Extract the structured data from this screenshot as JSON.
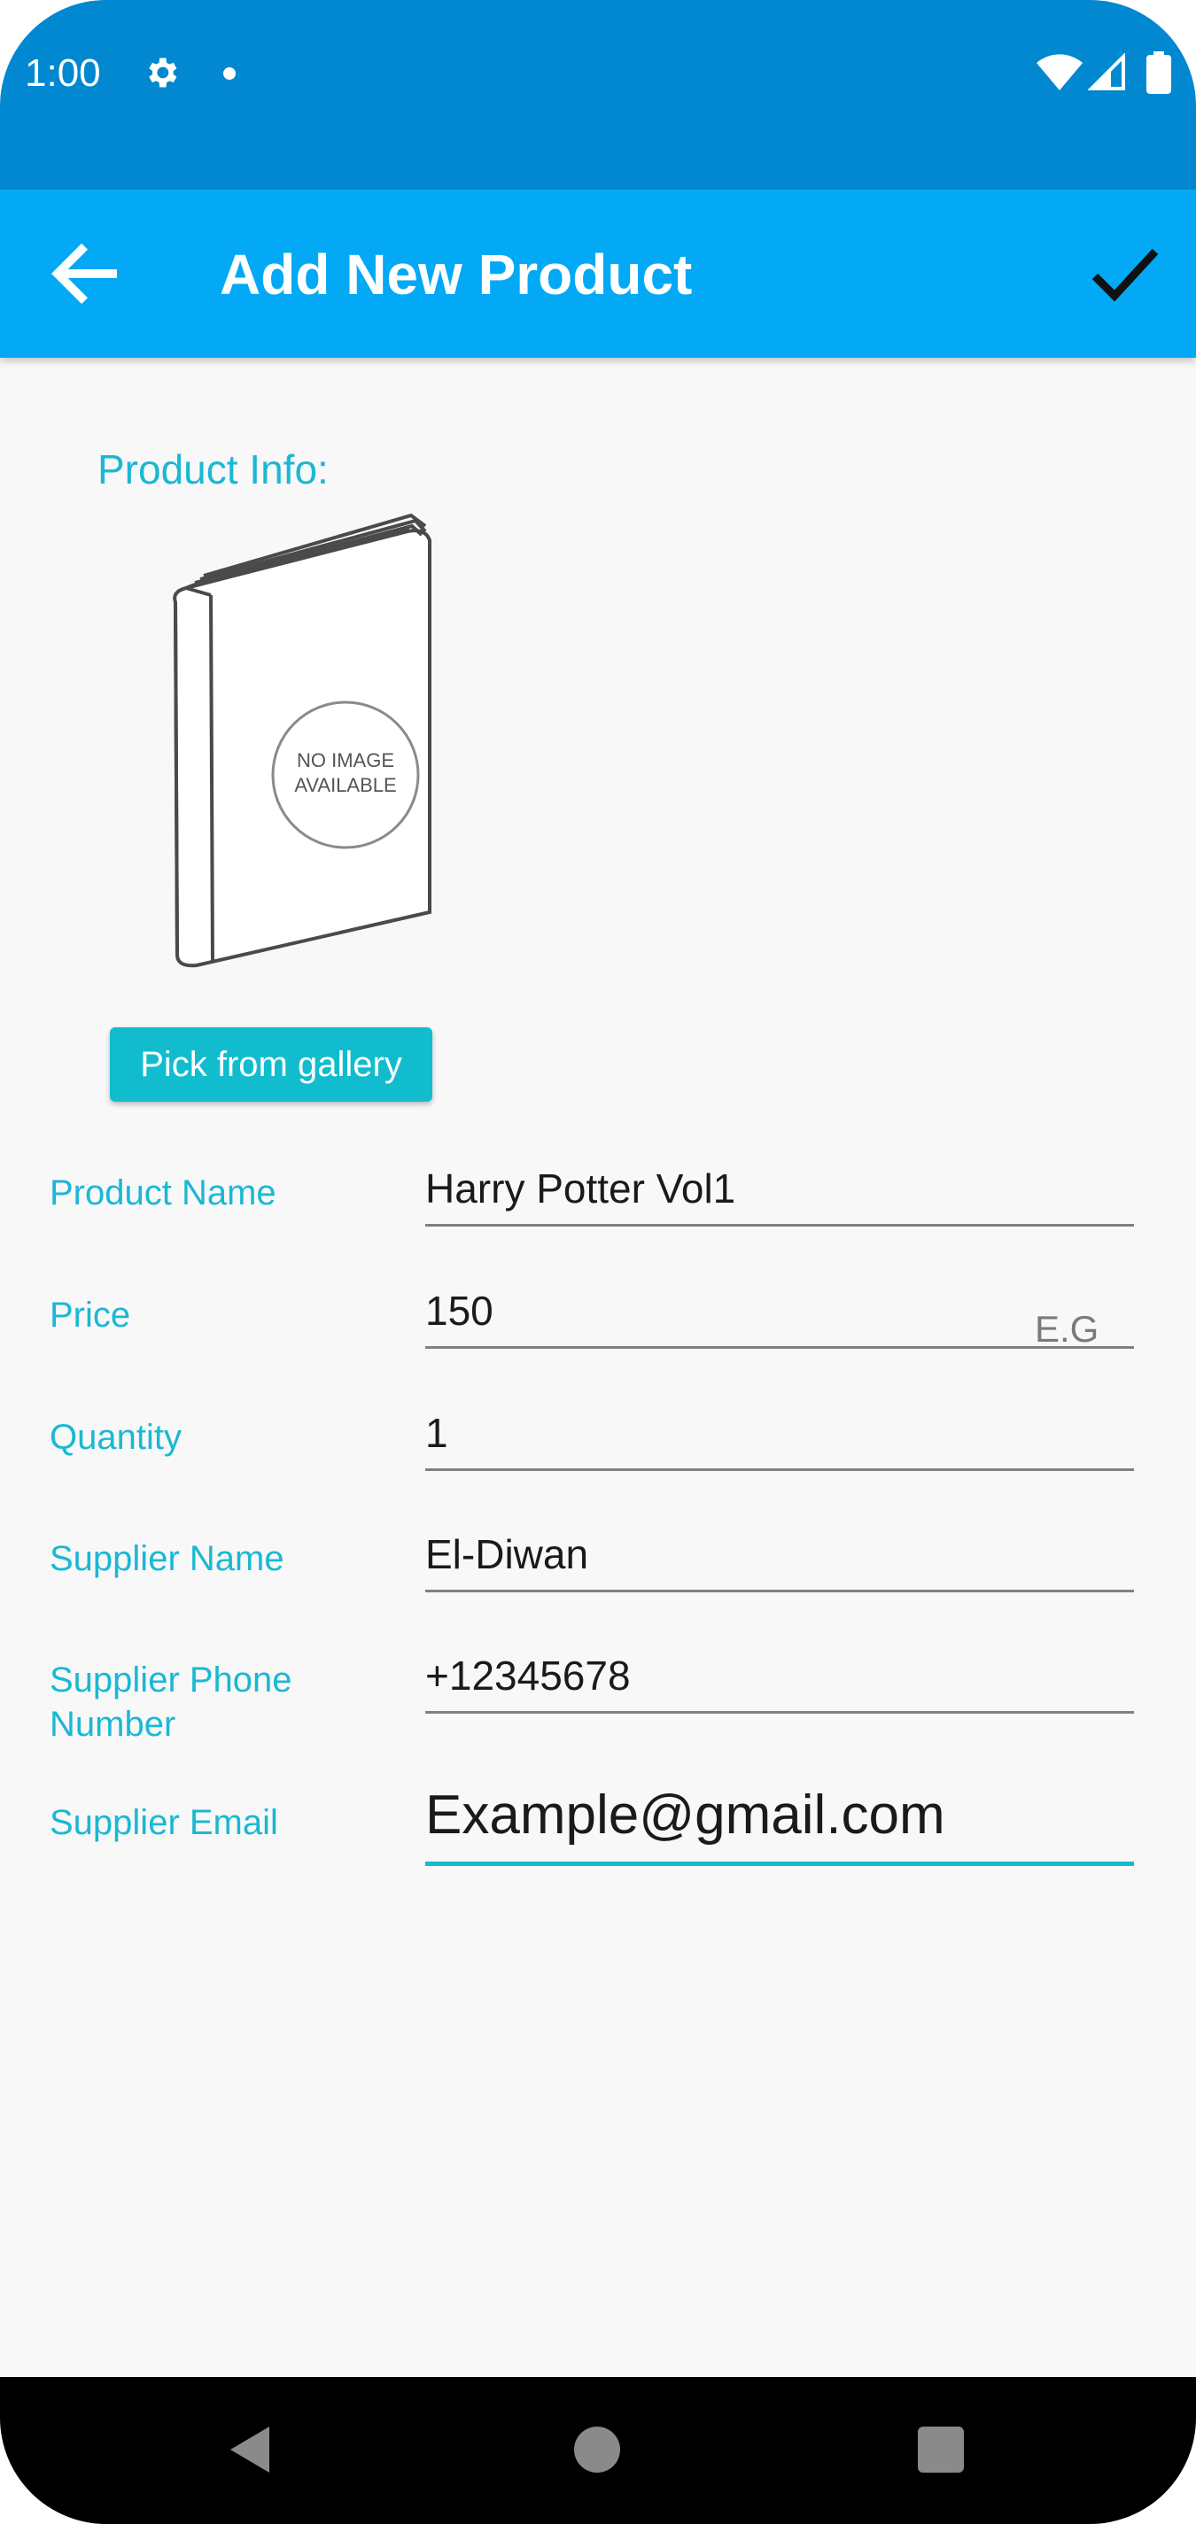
{
  "status_bar": {
    "time": "1:00",
    "icons": [
      "gear-icon",
      "notification-dot-icon",
      "wifi-icon",
      "signal-icon",
      "battery-icon"
    ]
  },
  "app_bar": {
    "title": "Add New Product",
    "back_icon": "arrow-left-icon",
    "save_icon": "check-icon",
    "color": "#03a9f4"
  },
  "form": {
    "section_title": "Product Info:",
    "image_placeholder_text": [
      "NO IMAGE",
      "AVAILABLE"
    ],
    "pick_button_label": "Pick from gallery",
    "fields": {
      "product_name": {
        "label": "Product Name",
        "value": "Harry Potter Vol1"
      },
      "price": {
        "label": "Price",
        "value": "150",
        "suffix": "E.G"
      },
      "quantity": {
        "label": "Quantity",
        "value": "1"
      },
      "supplier_name": {
        "label": "Supplier Name",
        "value": "El-Diwan"
      },
      "supplier_phone": {
        "label": "Supplier Phone Number",
        "value": "+12345678"
      },
      "supplier_email": {
        "label": "Supplier Email",
        "value": "Example@gmail.com"
      }
    },
    "accent_color": "#12bccf"
  },
  "nav_bar": {
    "icons": [
      "nav-back-icon",
      "nav-home-icon",
      "nav-recents-icon"
    ]
  }
}
